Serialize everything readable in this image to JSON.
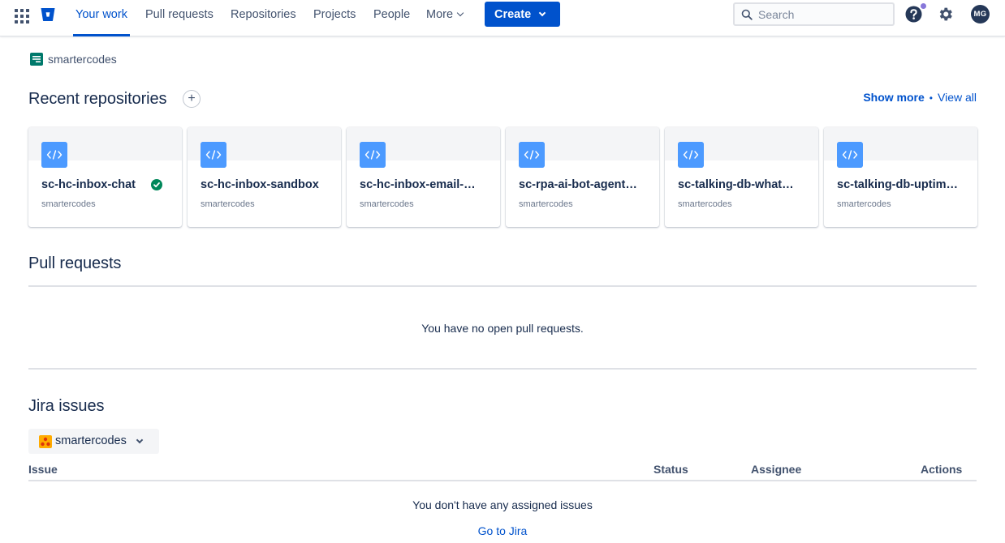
{
  "nav": {
    "items": [
      {
        "label": "Your work",
        "active": true
      },
      {
        "label": "Pull requests",
        "active": false
      },
      {
        "label": "Repositories",
        "active": false
      },
      {
        "label": "Projects",
        "active": false
      },
      {
        "label": "People",
        "active": false
      },
      {
        "label": "More",
        "active": false
      }
    ],
    "create_label": "Create",
    "search_placeholder": "Search",
    "avatar_initials": "MG",
    "accent_color": "#0052CC"
  },
  "workspace": {
    "name": "smartercodes"
  },
  "recent_repos": {
    "title": "Recent repositories",
    "add_label": "+",
    "show_more": "Show more",
    "separator": "•",
    "view_all": "View all",
    "repos": [
      {
        "name": "sc-hc-inbox-chat",
        "workspace": "smartercodes",
        "status": "success"
      },
      {
        "name": "sc-hc-inbox-sandbox",
        "workspace": "smartercodes",
        "status": ""
      },
      {
        "name": "sc-hc-inbox-email-ext…",
        "workspace": "smartercodes",
        "status": ""
      },
      {
        "name": "sc-rpa-ai-bot-agent-vdi",
        "workspace": "smartercodes",
        "status": ""
      },
      {
        "name": "sc-talking-db-whatsa…",
        "workspace": "smartercodes",
        "status": ""
      },
      {
        "name": "sc-talking-db-uptime-…",
        "workspace": "smartercodes",
        "status": ""
      }
    ]
  },
  "pull_requests": {
    "title": "Pull requests",
    "empty_message": "You have no open pull requests."
  },
  "jira": {
    "title": "Jira issues",
    "site_selector": "smartercodes",
    "columns": {
      "issue": "Issue",
      "status": "Status",
      "assignee": "Assignee",
      "actions": "Actions"
    },
    "empty_message": "You don't have any assigned issues",
    "go_to_jira": "Go to Jira"
  }
}
